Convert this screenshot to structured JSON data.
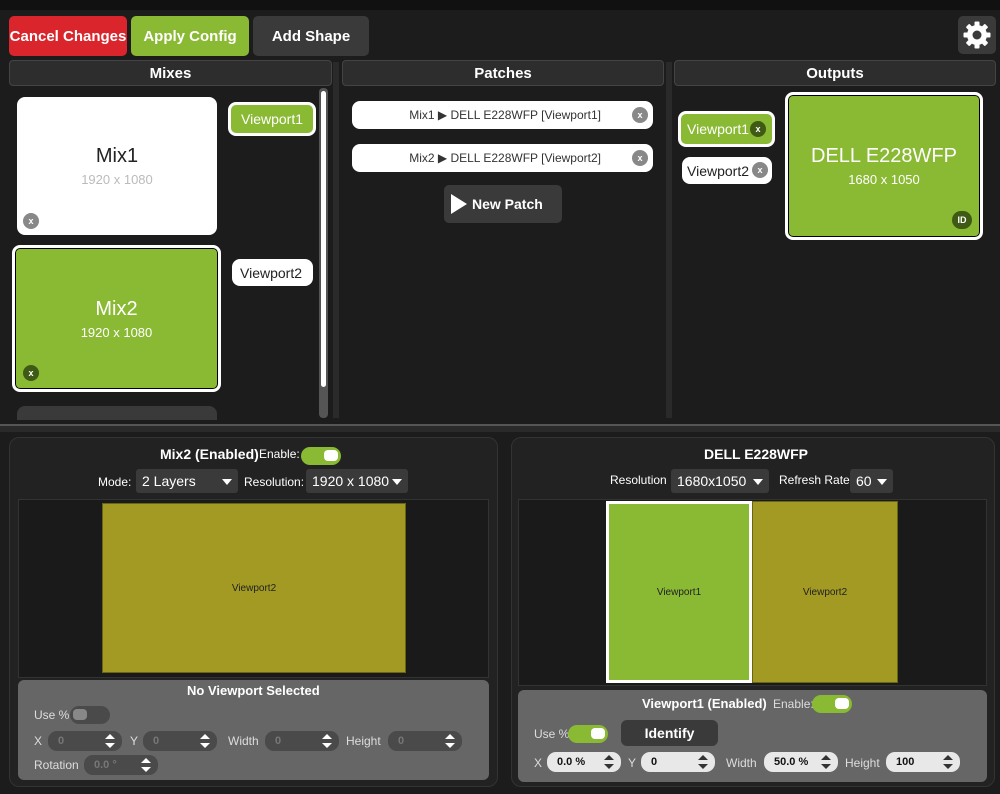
{
  "toolbar": {
    "cancel_label": "Cancel Changes",
    "apply_label": "Apply Config",
    "add_shape_label": "Add Shape"
  },
  "mixes": {
    "header": "Mixes",
    "cards": [
      {
        "name": "Mix1",
        "resolution": "1920 x 1080",
        "close": "x"
      },
      {
        "name": "Mix2",
        "resolution": "1920 x 1080",
        "close": "x"
      }
    ],
    "viewports": [
      "Viewport1",
      "Viewport2"
    ]
  },
  "patches": {
    "header": "Patches",
    "items": [
      {
        "text": "Mix1  ▶  DELL E228WFP [Viewport1]",
        "close": "x"
      },
      {
        "text": "Mix2  ▶  DELL E228WFP [Viewport2]",
        "close": "x"
      }
    ],
    "new_patch_label": "New Patch"
  },
  "outputs": {
    "header": "Outputs",
    "viewports": [
      {
        "label": "Viewport1",
        "close": "x"
      },
      {
        "label": "Viewport2",
        "close": "x"
      }
    ],
    "monitor": {
      "name": "DELL E228WFP",
      "resolution": "1680 x 1050",
      "badge": "ID"
    }
  },
  "mix_editor": {
    "title": "Mix2 (Enabled)",
    "enable_label": "Enable:",
    "mode_label": "Mode:",
    "mode_value": "2 Layers",
    "resolution_label": "Resolution:",
    "resolution_value": "1920 x 1080",
    "canvas_viewport": "Viewport2",
    "props_title": "No Viewport Selected",
    "use_pct_label": "Use %",
    "x_label": "X",
    "x_value": "0",
    "y_label": "Y",
    "y_value": "0",
    "width_label": "Width",
    "width_value": "0",
    "height_label": "Height",
    "height_value": "0",
    "rotation_label": "Rotation",
    "rotation_value": "0.0 °"
  },
  "output_editor": {
    "title": "DELL E228WFP",
    "resolution_label": "Resolution",
    "resolution_value": "1680x1050",
    "refresh_label": "Refresh Rate",
    "refresh_value": "60",
    "canvas_viewports": [
      "Viewport1",
      "Viewport2"
    ],
    "props_title": "Viewport1 (Enabled)",
    "enable_label": "Enable:",
    "use_pct_label": "Use %",
    "identify_label": "Identify",
    "x_label": "X",
    "x_value": "0.0 %",
    "y_label": "Y",
    "y_value": "0",
    "width_label": "Width",
    "width_value": "50.0 %",
    "height_label": "Height",
    "height_value": "100"
  },
  "colors": {
    "accent_green": "#8ab934",
    "olive": "#a39a23",
    "danger_red": "#d9252b",
    "panel_gray": "#666666"
  }
}
